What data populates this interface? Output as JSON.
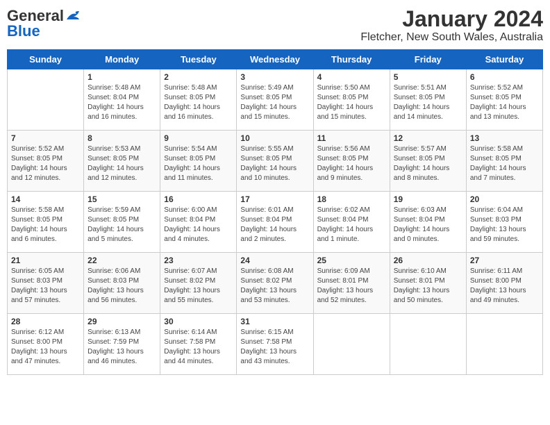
{
  "logo": {
    "line1": "General",
    "line2": "Blue"
  },
  "title": "January 2024",
  "subtitle": "Fletcher, New South Wales, Australia",
  "days_of_week": [
    "Sunday",
    "Monday",
    "Tuesday",
    "Wednesday",
    "Thursday",
    "Friday",
    "Saturday"
  ],
  "weeks": [
    [
      {
        "day": "",
        "info": ""
      },
      {
        "day": "1",
        "info": "Sunrise: 5:48 AM\nSunset: 8:04 PM\nDaylight: 14 hours\nand 16 minutes."
      },
      {
        "day": "2",
        "info": "Sunrise: 5:48 AM\nSunset: 8:05 PM\nDaylight: 14 hours\nand 16 minutes."
      },
      {
        "day": "3",
        "info": "Sunrise: 5:49 AM\nSunset: 8:05 PM\nDaylight: 14 hours\nand 15 minutes."
      },
      {
        "day": "4",
        "info": "Sunrise: 5:50 AM\nSunset: 8:05 PM\nDaylight: 14 hours\nand 15 minutes."
      },
      {
        "day": "5",
        "info": "Sunrise: 5:51 AM\nSunset: 8:05 PM\nDaylight: 14 hours\nand 14 minutes."
      },
      {
        "day": "6",
        "info": "Sunrise: 5:52 AM\nSunset: 8:05 PM\nDaylight: 14 hours\nand 13 minutes."
      }
    ],
    [
      {
        "day": "7",
        "info": "Sunrise: 5:52 AM\nSunset: 8:05 PM\nDaylight: 14 hours\nand 12 minutes."
      },
      {
        "day": "8",
        "info": "Sunrise: 5:53 AM\nSunset: 8:05 PM\nDaylight: 14 hours\nand 12 minutes."
      },
      {
        "day": "9",
        "info": "Sunrise: 5:54 AM\nSunset: 8:05 PM\nDaylight: 14 hours\nand 11 minutes."
      },
      {
        "day": "10",
        "info": "Sunrise: 5:55 AM\nSunset: 8:05 PM\nDaylight: 14 hours\nand 10 minutes."
      },
      {
        "day": "11",
        "info": "Sunrise: 5:56 AM\nSunset: 8:05 PM\nDaylight: 14 hours\nand 9 minutes."
      },
      {
        "day": "12",
        "info": "Sunrise: 5:57 AM\nSunset: 8:05 PM\nDaylight: 14 hours\nand 8 minutes."
      },
      {
        "day": "13",
        "info": "Sunrise: 5:58 AM\nSunset: 8:05 PM\nDaylight: 14 hours\nand 7 minutes."
      }
    ],
    [
      {
        "day": "14",
        "info": "Sunrise: 5:58 AM\nSunset: 8:05 PM\nDaylight: 14 hours\nand 6 minutes."
      },
      {
        "day": "15",
        "info": "Sunrise: 5:59 AM\nSunset: 8:05 PM\nDaylight: 14 hours\nand 5 minutes."
      },
      {
        "day": "16",
        "info": "Sunrise: 6:00 AM\nSunset: 8:04 PM\nDaylight: 14 hours\nand 4 minutes."
      },
      {
        "day": "17",
        "info": "Sunrise: 6:01 AM\nSunset: 8:04 PM\nDaylight: 14 hours\nand 2 minutes."
      },
      {
        "day": "18",
        "info": "Sunrise: 6:02 AM\nSunset: 8:04 PM\nDaylight: 14 hours\nand 1 minute."
      },
      {
        "day": "19",
        "info": "Sunrise: 6:03 AM\nSunset: 8:04 PM\nDaylight: 14 hours\nand 0 minutes."
      },
      {
        "day": "20",
        "info": "Sunrise: 6:04 AM\nSunset: 8:03 PM\nDaylight: 13 hours\nand 59 minutes."
      }
    ],
    [
      {
        "day": "21",
        "info": "Sunrise: 6:05 AM\nSunset: 8:03 PM\nDaylight: 13 hours\nand 57 minutes."
      },
      {
        "day": "22",
        "info": "Sunrise: 6:06 AM\nSunset: 8:03 PM\nDaylight: 13 hours\nand 56 minutes."
      },
      {
        "day": "23",
        "info": "Sunrise: 6:07 AM\nSunset: 8:02 PM\nDaylight: 13 hours\nand 55 minutes."
      },
      {
        "day": "24",
        "info": "Sunrise: 6:08 AM\nSunset: 8:02 PM\nDaylight: 13 hours\nand 53 minutes."
      },
      {
        "day": "25",
        "info": "Sunrise: 6:09 AM\nSunset: 8:01 PM\nDaylight: 13 hours\nand 52 minutes."
      },
      {
        "day": "26",
        "info": "Sunrise: 6:10 AM\nSunset: 8:01 PM\nDaylight: 13 hours\nand 50 minutes."
      },
      {
        "day": "27",
        "info": "Sunrise: 6:11 AM\nSunset: 8:00 PM\nDaylight: 13 hours\nand 49 minutes."
      }
    ],
    [
      {
        "day": "28",
        "info": "Sunrise: 6:12 AM\nSunset: 8:00 PM\nDaylight: 13 hours\nand 47 minutes."
      },
      {
        "day": "29",
        "info": "Sunrise: 6:13 AM\nSunset: 7:59 PM\nDaylight: 13 hours\nand 46 minutes."
      },
      {
        "day": "30",
        "info": "Sunrise: 6:14 AM\nSunset: 7:58 PM\nDaylight: 13 hours\nand 44 minutes."
      },
      {
        "day": "31",
        "info": "Sunrise: 6:15 AM\nSunset: 7:58 PM\nDaylight: 13 hours\nand 43 minutes."
      },
      {
        "day": "",
        "info": ""
      },
      {
        "day": "",
        "info": ""
      },
      {
        "day": "",
        "info": ""
      }
    ]
  ]
}
